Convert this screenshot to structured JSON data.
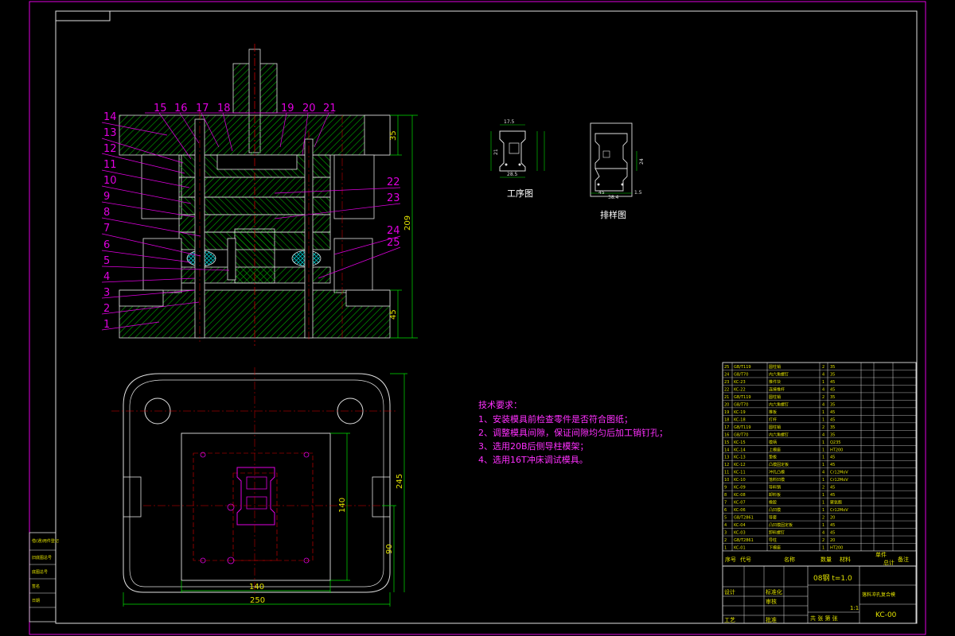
{
  "colors": {
    "background": "#000000",
    "border": "#e000e0",
    "dimension": "#00e000",
    "hatch": "#00c000",
    "centerline": "#e00000",
    "note": "#ff30ff",
    "text": "#e0e000"
  },
  "section_labels": {
    "top": [
      "15",
      "16",
      "17",
      "18",
      "19",
      "20",
      "21"
    ],
    "left": [
      "14",
      "13",
      "12",
      "11",
      "10",
      "9",
      "8",
      "7",
      "6",
      "5",
      "4",
      "3",
      "2",
      "1"
    ],
    "right": [
      "22",
      "23",
      "24",
      "25"
    ]
  },
  "dimensions": {
    "height_total": "209",
    "height_top": "35",
    "height_bottom": "45",
    "plan_width": "250",
    "plan_inner_width": "140",
    "plan_height": "245",
    "plan_inner_height": "140",
    "plan_offset": "90"
  },
  "process_view": {
    "label": "工序图",
    "dim_top": "17.5",
    "dim_width": "28.5",
    "dim_side": "21"
  },
  "layout_view": {
    "label": "排样图",
    "dim_a": "45",
    "dim_b": "38.4",
    "dim_c": "1.5",
    "dim_d": "24"
  },
  "tech_requirements": {
    "title": "技术要求：",
    "items": [
      "1、安装模具前检查零件是否符合图纸；",
      "2、调整模具间隙，保证间隙均匀后加工销钉孔；",
      "3、选用20B后侧导柱模架；",
      "4、选用16T冲床调试模具。"
    ]
  },
  "title_block": {
    "material": "08钢 t=1.0",
    "drawing_no": "KC-00",
    "drawing_name": "落料冲孔复合模",
    "scale": "1:1",
    "sheet_info": "共 张  第 张",
    "headers": [
      "序号",
      "代号",
      "名称",
      "数量",
      "材料",
      "单件",
      "总计",
      "备注"
    ],
    "sign_rows": [
      "设计",
      "标准化",
      "审核",
      "工艺",
      "批准"
    ],
    "left_side_labels": [
      "借(通)用件登记",
      "旧底图总号",
      "底图总号",
      "签名",
      "日期"
    ]
  },
  "parts_list": [
    {
      "no": "25",
      "code": "GB/T119",
      "name": "圆柱销",
      "qty": "2",
      "mat": "35"
    },
    {
      "no": "24",
      "code": "GB/T70",
      "name": "内六角螺钉",
      "qty": "4",
      "mat": "35"
    },
    {
      "no": "23",
      "code": "KC-23",
      "name": "推件块",
      "qty": "1",
      "mat": "45"
    },
    {
      "no": "22",
      "code": "KC-22",
      "name": "连接推杆",
      "qty": "4",
      "mat": "45"
    },
    {
      "no": "21",
      "code": "GB/T119",
      "name": "圆柱销",
      "qty": "2",
      "mat": "35"
    },
    {
      "no": "20",
      "code": "GB/T70",
      "name": "内六角螺钉",
      "qty": "4",
      "mat": "35"
    },
    {
      "no": "19",
      "code": "KC-19",
      "name": "推板",
      "qty": "1",
      "mat": "45"
    },
    {
      "no": "18",
      "code": "KC-18",
      "name": "打杆",
      "qty": "1",
      "mat": "45"
    },
    {
      "no": "17",
      "code": "GB/T119",
      "name": "圆柱销",
      "qty": "2",
      "mat": "35"
    },
    {
      "no": "16",
      "code": "GB/T70",
      "name": "内六角螺钉",
      "qty": "4",
      "mat": "35"
    },
    {
      "no": "15",
      "code": "KC-15",
      "name": "模柄",
      "qty": "1",
      "mat": "Q235"
    },
    {
      "no": "14",
      "code": "KC-14",
      "name": "上模座",
      "qty": "1",
      "mat": "HT200"
    },
    {
      "no": "13",
      "code": "KC-13",
      "name": "垫板",
      "qty": "1",
      "mat": "45"
    },
    {
      "no": "12",
      "code": "KC-12",
      "name": "凸模固定板",
      "qty": "1",
      "mat": "45"
    },
    {
      "no": "11",
      "code": "KC-11",
      "name": "冲孔凸模",
      "qty": "4",
      "mat": "Cr12MoV"
    },
    {
      "no": "10",
      "code": "KC-10",
      "name": "落料凹模",
      "qty": "1",
      "mat": "Cr12MoV"
    },
    {
      "no": "9",
      "code": "KC-09",
      "name": "导料销",
      "qty": "2",
      "mat": "45"
    },
    {
      "no": "8",
      "code": "KC-08",
      "name": "卸料板",
      "qty": "1",
      "mat": "45"
    },
    {
      "no": "7",
      "code": "KC-07",
      "name": "橡胶",
      "qty": "1",
      "mat": "聚氨酯"
    },
    {
      "no": "6",
      "code": "KC-06",
      "name": "凸凹模",
      "qty": "1",
      "mat": "Cr12MoV"
    },
    {
      "no": "5",
      "code": "GB/T2861",
      "name": "导套",
      "qty": "2",
      "mat": "20"
    },
    {
      "no": "4",
      "code": "KC-04",
      "name": "凸凹模固定板",
      "qty": "1",
      "mat": "45"
    },
    {
      "no": "3",
      "code": "KC-03",
      "name": "卸料螺钉",
      "qty": "4",
      "mat": "45"
    },
    {
      "no": "2",
      "code": "GB/T2861",
      "name": "导柱",
      "qty": "2",
      "mat": "20"
    },
    {
      "no": "1",
      "code": "KC-01",
      "name": "下模座",
      "qty": "1",
      "mat": "HT200"
    }
  ]
}
